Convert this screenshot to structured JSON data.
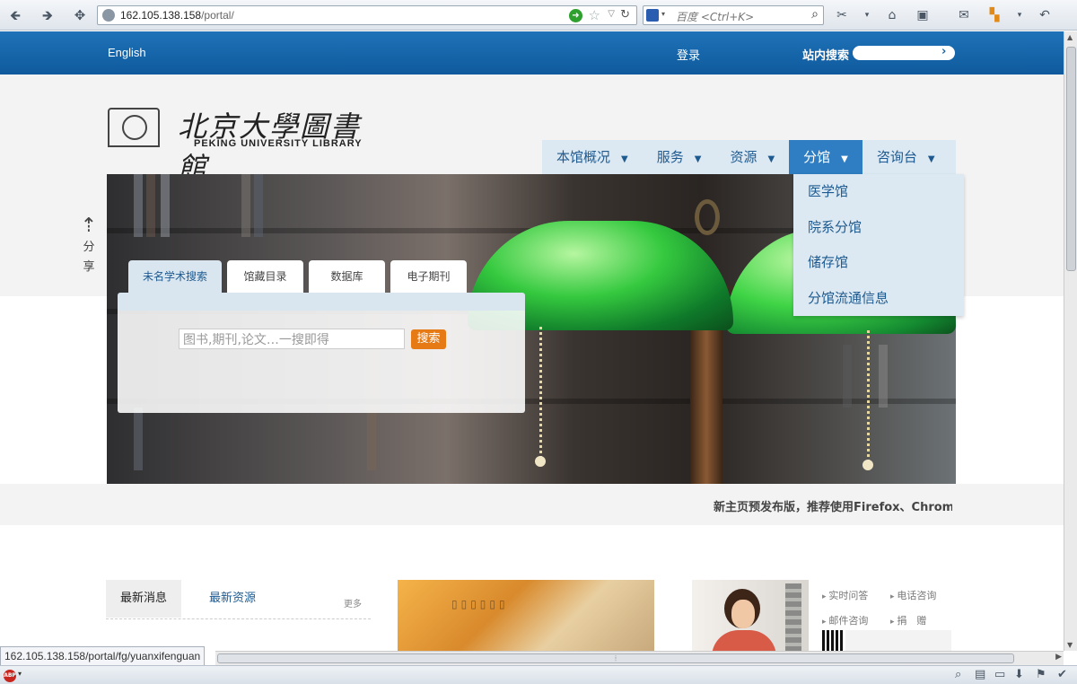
{
  "browser": {
    "url_host": "162.105.138.158",
    "url_path": "/portal/",
    "search_placeholder": "百度 <Ctrl+K>",
    "status_url": "162.105.138.158/portal/fg/yuanxifenguan"
  },
  "topbar": {
    "english": "English",
    "login": "登录",
    "site_search_label": "站内搜索"
  },
  "logo": {
    "cn": "北京大學圖書館",
    "en": "PEKING UNIVERSITY LIBRARY"
  },
  "nav": [
    {
      "label": "本馆概况"
    },
    {
      "label": "服务"
    },
    {
      "label": "资源"
    },
    {
      "label": "分馆"
    },
    {
      "label": "咨询台"
    }
  ],
  "dropdown": [
    "医学馆",
    "院系分馆",
    "储存馆",
    "分馆流通信息"
  ],
  "search": {
    "tabs": [
      "未名学术搜索",
      "馆藏目录",
      "数据库",
      "电子期刊"
    ],
    "placeholder": "图书,期刊,论文…一搜即得",
    "button": "搜索"
  },
  "share": {
    "char1": "分",
    "char2": "享"
  },
  "notice": "新主页预发布版，推荐使用Firefox、Chrome",
  "news": {
    "tab_latest": "最新消息",
    "tab_resources": "最新资源",
    "more": "更多"
  },
  "consult": {
    "links": [
      "实时问答",
      "电话咨询",
      "邮件咨询",
      "捐　赠"
    ]
  }
}
